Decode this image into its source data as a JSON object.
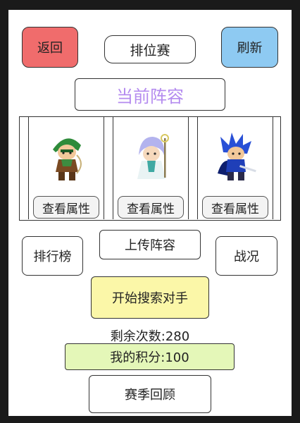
{
  "header": {
    "back_label": "返回",
    "mode_label": "排位赛",
    "refresh_label": "刷新"
  },
  "lineup": {
    "title": "当前阵容",
    "slots": [
      {
        "sprite": "green-archer-sprite",
        "button_label": "查看属性"
      },
      {
        "sprite": "white-mage-sprite",
        "button_label": "查看属性"
      },
      {
        "sprite": "blue-swordsman-sprite",
        "button_label": "查看属性"
      }
    ]
  },
  "actions": {
    "rank_label": "排行榜",
    "upload_label": "上传阵容",
    "battle_label": "战况",
    "search_label": "开始搜索对手"
  },
  "status": {
    "remaining_text": "剩余次数:280",
    "score_text": "我的积分:100"
  },
  "footer": {
    "season_label": "赛季回顾"
  },
  "colors": {
    "back_button": "#f06c6c",
    "refresh_button": "#8ecaf2",
    "lineup_title": "#b48bef",
    "search_button": "#fbf7a8",
    "score_box": "#e4f7b8"
  }
}
